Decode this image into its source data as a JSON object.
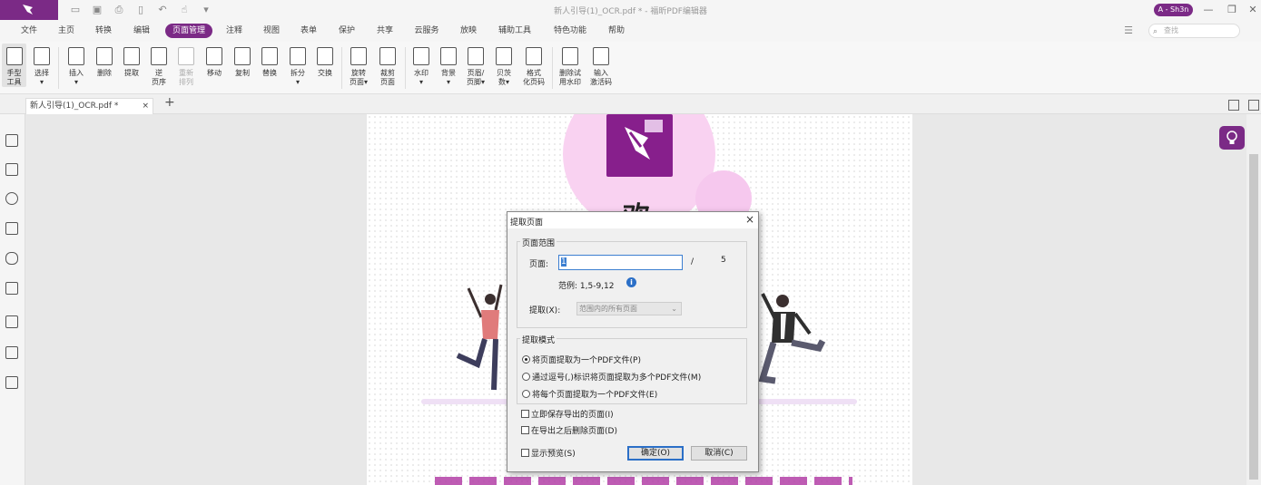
{
  "app": {
    "window_title": "新人引导(1)_OCR.pdf * - 福昕PDF编辑器",
    "user_badge": "A - Sh3n"
  },
  "menu": {
    "items": [
      "文件",
      "主页",
      "转换",
      "编辑",
      "页面管理",
      "注释",
      "视图",
      "表单",
      "保护",
      "共享",
      "云服务",
      "放映",
      "辅助工具",
      "特色功能",
      "帮助"
    ],
    "active": "页面管理"
  },
  "search": {
    "placeholder": "查找"
  },
  "ribbon": {
    "items": [
      {
        "l1": "手型",
        "l2": "工具"
      },
      {
        "l1": "选择",
        "l2": "▾"
      },
      {
        "l1": "插入",
        "l2": "▾"
      },
      {
        "l1": "删除",
        "l2": ""
      },
      {
        "l1": "提取",
        "l2": ""
      },
      {
        "l1": "逆",
        "l2": "页序"
      },
      {
        "l1": "重新",
        "l2": "排列"
      },
      {
        "l1": "移动",
        "l2": ""
      },
      {
        "l1": "复制",
        "l2": ""
      },
      {
        "l1": "替换",
        "l2": ""
      },
      {
        "l1": "拆分",
        "l2": "▾"
      },
      {
        "l1": "交换",
        "l2": ""
      },
      {
        "l1": "旋转",
        "l2": "页面▾"
      },
      {
        "l1": "裁剪",
        "l2": "页面"
      },
      {
        "l1": "水印",
        "l2": "▾"
      },
      {
        "l1": "背景",
        "l2": "▾"
      },
      {
        "l1": "页眉/",
        "l2": "页脚▾"
      },
      {
        "l1": "贝茨",
        "l2": "数▾"
      },
      {
        "l1": "格式",
        "l2": "化页码"
      },
      {
        "l1": "删除试",
        "l2": "用水印"
      },
      {
        "l1": "输入",
        "l2": "激活码"
      }
    ]
  },
  "tabs": {
    "doc_tab": "新人引导(1)_OCR.pdf *",
    "close": "×",
    "add": "+"
  },
  "page": {
    "big_char": "欢"
  },
  "dialog": {
    "title": "提取页面",
    "close": "×",
    "range_group": "页面范围",
    "page_label": "页面:",
    "page_value": "1",
    "slash": "/",
    "total_pages": "5",
    "example": "范例: 1,5-9,12",
    "info": "i",
    "extract_label": "提取(X):",
    "extract_value": "范围内的所有页面",
    "mode_group": "提取模式",
    "mode_options": [
      "将页面提取为一个PDF文件(P)",
      "通过逗号(,)标识将页面提取为多个PDF文件(M)",
      "将每个页面提取为一个PDF文件(E)"
    ],
    "selected_mode": 0,
    "checks": [
      "立即保存导出的页面(I)",
      "在导出之后删除页面(D)"
    ],
    "preview": "显示预览(S)",
    "ok": "确定(O)",
    "cancel": "取消(C)"
  }
}
